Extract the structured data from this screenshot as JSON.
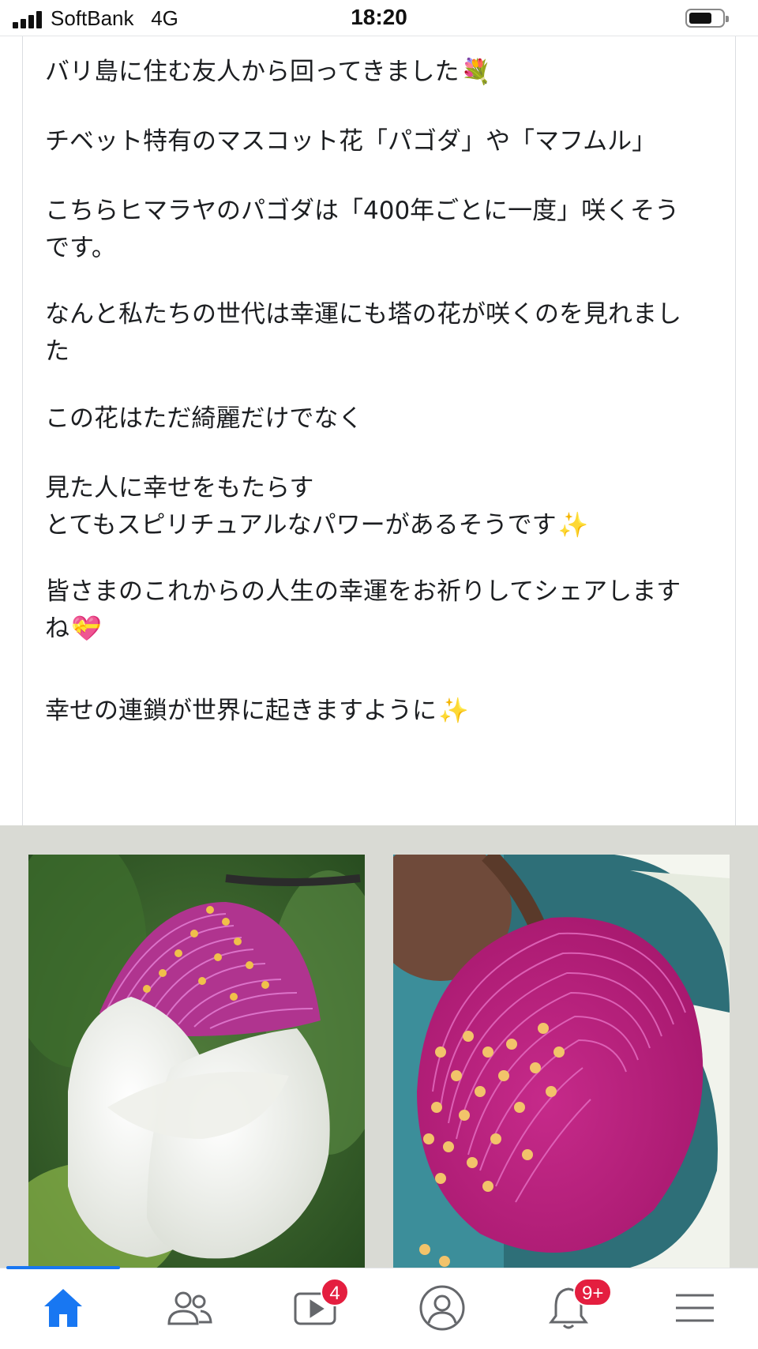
{
  "status_bar": {
    "carrier": "SoftBank",
    "network": "4G",
    "time": "18:20",
    "battery_level": 0.7
  },
  "post": {
    "paragraphs": [
      {
        "lines": [
          "バリ島に住む友人から回ってきました"
        ],
        "emoji": "💐"
      },
      {
        "lines": [
          "チベット特有のマスコット花「パゴダ」や「マフムル」"
        ],
        "emoji": ""
      },
      {
        "lines": [
          "こちらヒマラヤのパゴダは「400年ごとに一度」咲くそう",
          "です。"
        ],
        "emoji": ""
      },
      {
        "lines": [
          "なんと私たちの世代は幸運にも塔の花が咲くのを見れまし",
          "た"
        ],
        "emoji": ""
      },
      {
        "lines": [
          "この花はただ綺麗だけでなく"
        ],
        "emoji": ""
      },
      {
        "lines": [
          "見た人に幸せをもたらす",
          "とてもスピリチュアルなパワーがあるそうです"
        ],
        "emoji": "✨"
      },
      {
        "lines": [
          "皆さまのこれからの人生の幸運をお祈りしてシェアします",
          "ね"
        ],
        "emoji": "💝"
      },
      {
        "lines": [
          "幸せの連鎖が世界に起きますように"
        ],
        "emoji": "✨"
      }
    ]
  },
  "photos": [
    {
      "icon": "pagoda-flower-bud-photo"
    },
    {
      "icon": "pagoda-flower-bloom-photo"
    }
  ],
  "tabbar": {
    "tabs": [
      {
        "icon": "home-icon",
        "active": true,
        "badge": ""
      },
      {
        "icon": "friends-icon",
        "active": false,
        "badge": ""
      },
      {
        "icon": "watch-icon",
        "active": false,
        "badge": "4"
      },
      {
        "icon": "profile-icon",
        "active": false,
        "badge": ""
      },
      {
        "icon": "notifications-icon",
        "active": false,
        "badge": "9+"
      },
      {
        "icon": "menu-icon",
        "active": false,
        "badge": ""
      }
    ]
  },
  "colors": {
    "accent": "#1877f2",
    "badge": "#e41e3f",
    "gallery_bg": "#d9dad4",
    "icon_gray": "#65676b"
  }
}
